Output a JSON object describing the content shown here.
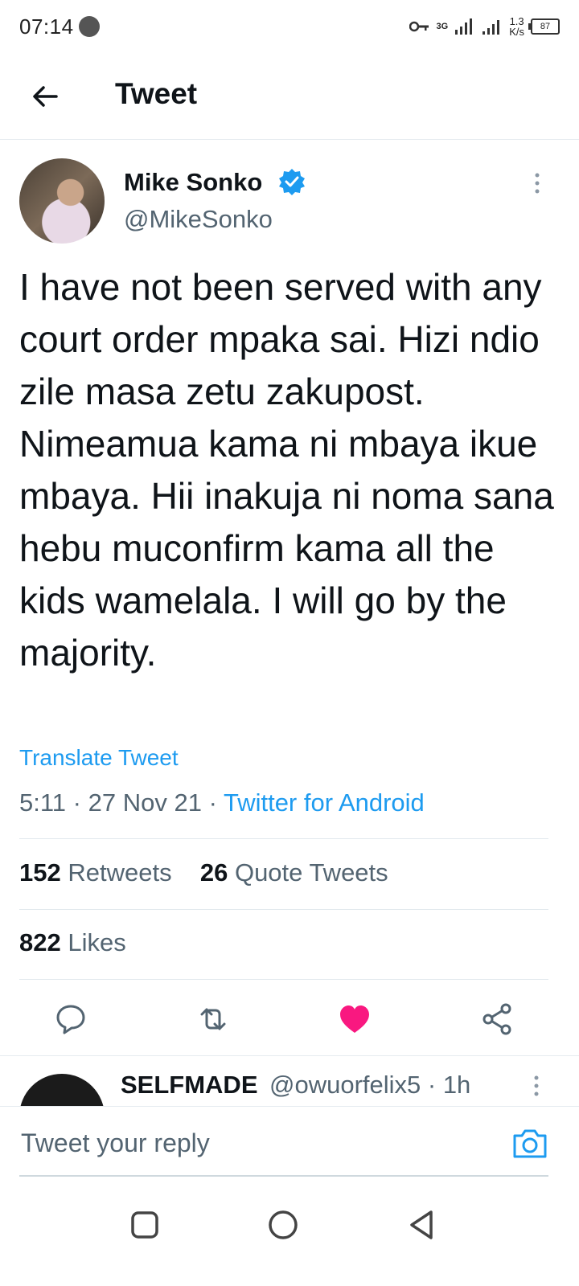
{
  "status_bar": {
    "time": "07:14",
    "network": "3G",
    "speed_value": "1.3",
    "speed_unit": "K/s",
    "battery": "87"
  },
  "header": {
    "title": "Tweet"
  },
  "tweet": {
    "author_name": "Mike Sonko",
    "author_handle": "@MikeSonko",
    "text": "I have not been served with any court order mpaka sai. Hizi ndio zile masa zetu zakupost. Nimeamua kama ni mbaya ikue mbaya. Hii inakuja ni noma sana hebu muconfirm kama all the kids wamelala. I will go by the majority.",
    "translate_label": "Translate Tweet",
    "time": "5:11",
    "date": "27 Nov 21",
    "separator": "·",
    "source": "Twitter for Android"
  },
  "stats": {
    "retweets_count": "152",
    "retweets_label": "Retweets",
    "quotes_count": "26",
    "quotes_label": "Quote Tweets",
    "likes_count": "822",
    "likes_label": "Likes"
  },
  "colors": {
    "accent": "#1d9bf0",
    "like": "#f91880",
    "secondary_text": "#536471"
  },
  "actions": [
    "reply-icon",
    "retweet-icon",
    "like-icon",
    "share-icon"
  ],
  "reply_preview": {
    "name": "SELFMADE",
    "handle_time": "@owuorfelix5 · 1h"
  },
  "reply_bar": {
    "placeholder": "Tweet your reply"
  },
  "nav": [
    "recents-icon",
    "home-icon",
    "back-triangle-icon"
  ]
}
